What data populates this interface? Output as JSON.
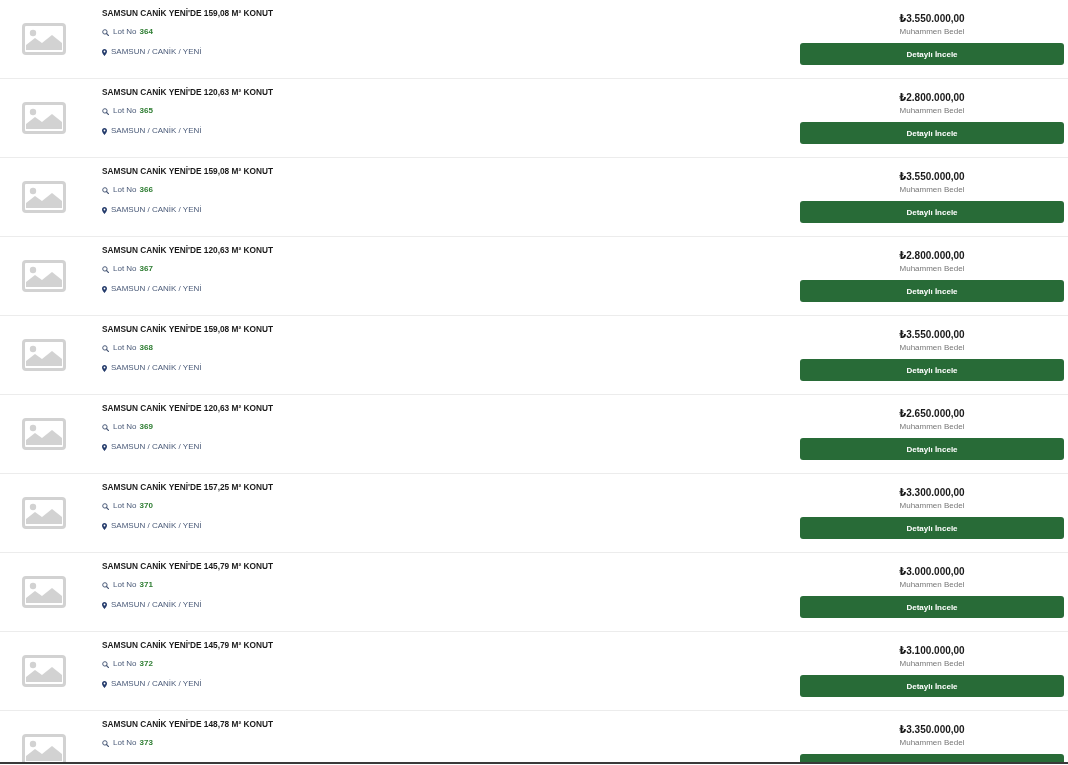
{
  "listings": [
    {
      "title": "SAMSUN CANİK YENİ'DE 159,08 M² KONUT",
      "lot_label": "Lot No",
      "lot_number": "364",
      "location": "SAMSUN / CANİK / YENİ",
      "price": "₺3.550.000,00",
      "price_label": "Muhammen Bedel",
      "button": "Detaylı İncele"
    },
    {
      "title": "SAMSUN CANİK YENİ'DE 120,63 M² KONUT",
      "lot_label": "Lot No",
      "lot_number": "365",
      "location": "SAMSUN / CANİK / YENİ",
      "price": "₺2.800.000,00",
      "price_label": "Muhammen Bedel",
      "button": "Detaylı İncele"
    },
    {
      "title": "SAMSUN CANİK YENİ'DE 159,08 M² KONUT",
      "lot_label": "Lot No",
      "lot_number": "366",
      "location": "SAMSUN / CANİK / YENİ",
      "price": "₺3.550.000,00",
      "price_label": "Muhammen Bedel",
      "button": "Detaylı İncele"
    },
    {
      "title": "SAMSUN CANİK YENİ'DE 120,63 M² KONUT",
      "lot_label": "Lot No",
      "lot_number": "367",
      "location": "SAMSUN / CANİK / YENİ",
      "price": "₺2.800.000,00",
      "price_label": "Muhammen Bedel",
      "button": "Detaylı İncele"
    },
    {
      "title": "SAMSUN CANİK YENİ'DE 159,08 M² KONUT",
      "lot_label": "Lot No",
      "lot_number": "368",
      "location": "SAMSUN / CANİK / YENİ",
      "price": "₺3.550.000,00",
      "price_label": "Muhammen Bedel",
      "button": "Detaylı İncele"
    },
    {
      "title": "SAMSUN CANİK YENİ'DE 120,63 M² KONUT",
      "lot_label": "Lot No",
      "lot_number": "369",
      "location": "SAMSUN / CANİK / YENİ",
      "price": "₺2.650.000,00",
      "price_label": "Muhammen Bedel",
      "button": "Detaylı İncele"
    },
    {
      "title": "SAMSUN CANİK YENİ'DE 157,25 M² KONUT",
      "lot_label": "Lot No",
      "lot_number": "370",
      "location": "SAMSUN / CANİK / YENİ",
      "price": "₺3.300.000,00",
      "price_label": "Muhammen Bedel",
      "button": "Detaylı İncele"
    },
    {
      "title": "SAMSUN CANİK YENİ'DE 145,79 M² KONUT",
      "lot_label": "Lot No",
      "lot_number": "371",
      "location": "SAMSUN / CANİK / YENİ",
      "price": "₺3.000.000,00",
      "price_label": "Muhammen Bedel",
      "button": "Detaylı İncele"
    },
    {
      "title": "SAMSUN CANİK YENİ'DE 145,79 M² KONUT",
      "lot_label": "Lot No",
      "lot_number": "372",
      "location": "SAMSUN / CANİK / YENİ",
      "price": "₺3.100.000,00",
      "price_label": "Muhammen Bedel",
      "button": "Detaylı İncele"
    },
    {
      "title": "SAMSUN CANİK YENİ'DE 148,78 M² KONUT",
      "lot_label": "Lot No",
      "lot_number": "373",
      "price": "₺3.350.000,00",
      "price_label": "Muhammen Bedel"
    }
  ]
}
